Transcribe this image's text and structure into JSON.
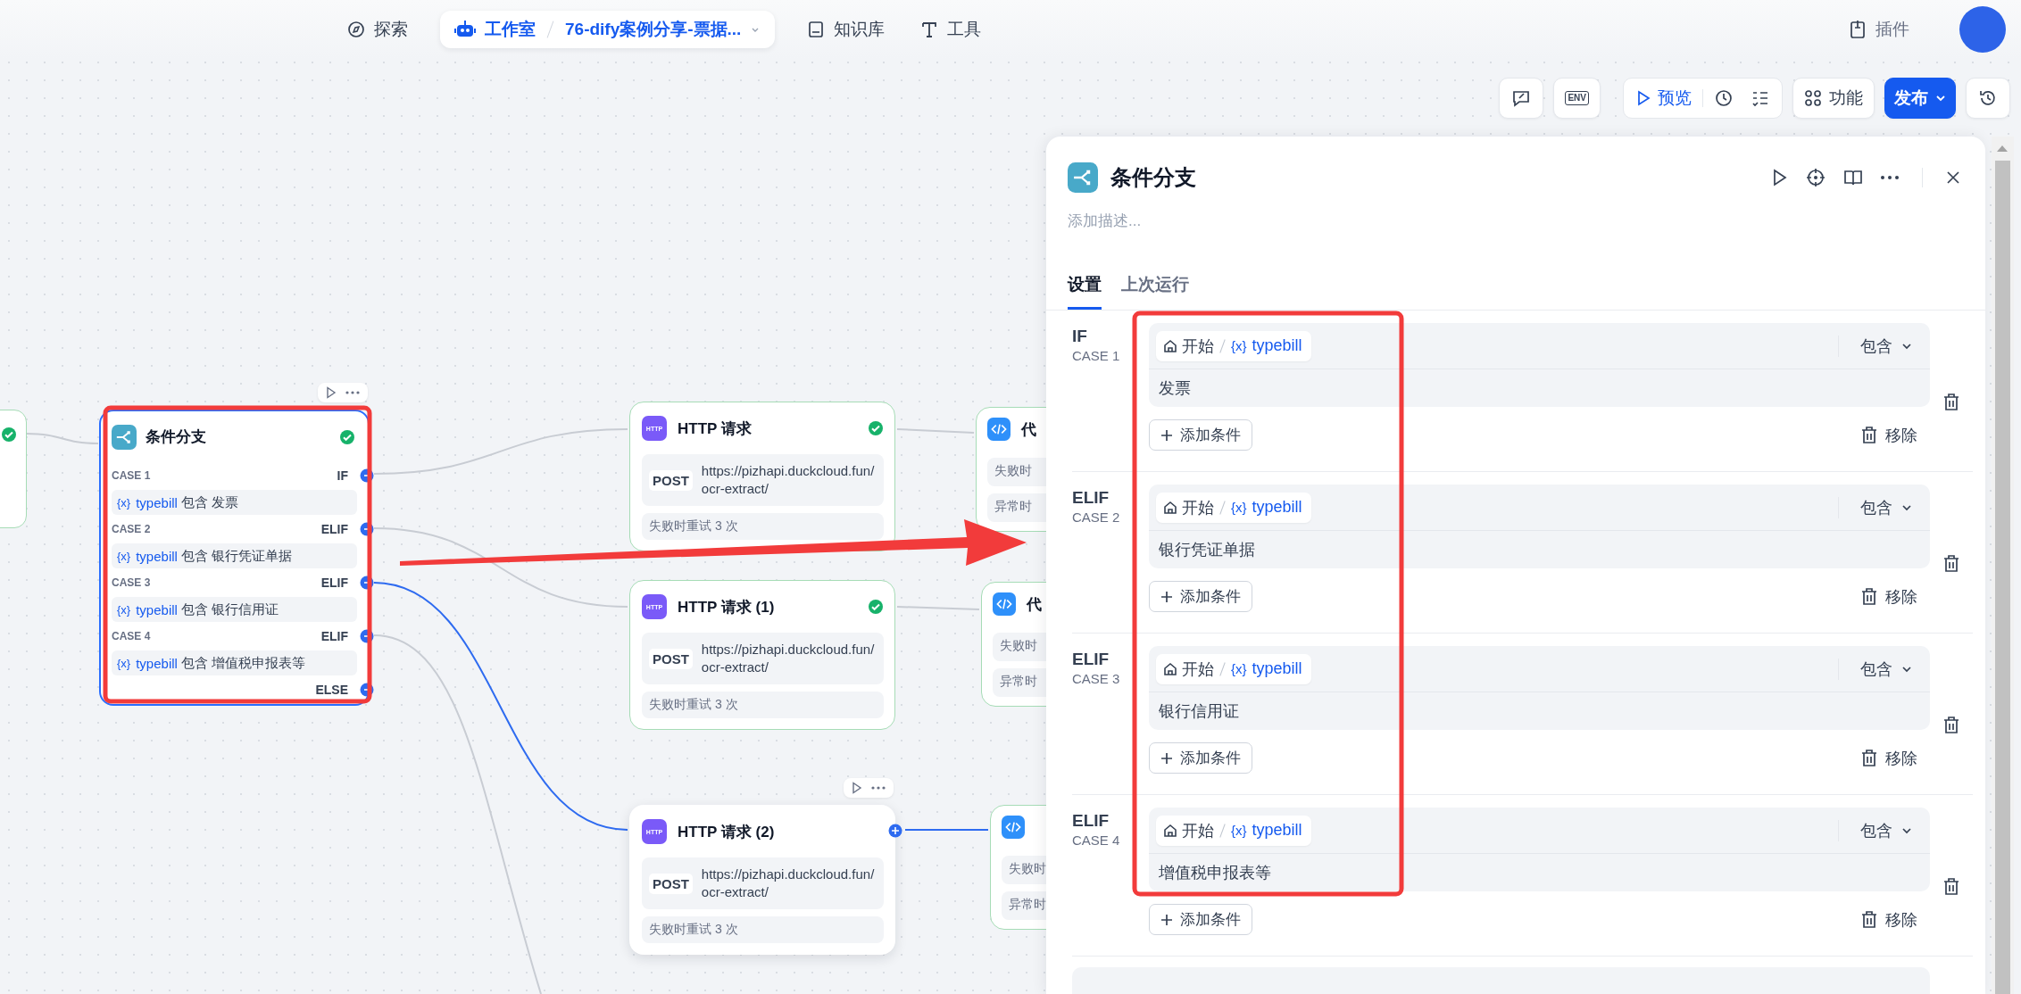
{
  "top_nav": {
    "items": [
      {
        "label": "探索",
        "selected": false
      },
      {
        "label": "工作室",
        "selected": true,
        "app_name": "76-dify案例分享-票据..."
      },
      {
        "label": "知识库",
        "selected": false
      },
      {
        "label": "工具",
        "selected": false
      }
    ],
    "plugins": "插件"
  },
  "canvas_toolbar": {
    "env": "ENV",
    "preview": "预览",
    "features": "功能",
    "publish": "发布"
  },
  "previous_node": {
    "succeeded": true
  },
  "if_else_node": {
    "title": "条件分支",
    "selected": true,
    "succeeded": true,
    "else": "ELSE",
    "cases": [
      {
        "case": "CASE 1",
        "branch": "IF",
        "var_symbol": "{x}",
        "variable": "typebill",
        "operator": "包含",
        "value": "发票"
      },
      {
        "case": "CASE 2",
        "branch": "ELIF",
        "var_symbol": "{x}",
        "variable": "typebill",
        "operator": "包含",
        "value": "银行凭证单据"
      },
      {
        "case": "CASE 3",
        "branch": "ELIF",
        "var_symbol": "{x}",
        "variable": "typebill",
        "operator": "包含",
        "value": "银行信用证"
      },
      {
        "case": "CASE 4",
        "branch": "ELIF",
        "var_symbol": "{x}",
        "variable": "typebill",
        "operator": "包含",
        "value": "增值税申报表等"
      }
    ]
  },
  "http_nodes": [
    {
      "title": "HTTP 请求",
      "icon_label": "HTTP",
      "method": "POST",
      "url": "https://pizhapi.duckcloud.fun/ocr-extract/",
      "retry": "失败时重试 3 次",
      "succeeded": true,
      "hovered": false
    },
    {
      "title": "HTTP 请求 (1)",
      "icon_label": "HTTP",
      "method": "POST",
      "url": "https://pizhapi.duckcloud.fun/ocr-extract/",
      "retry": "失败时重试 3 次",
      "succeeded": true,
      "hovered": false
    },
    {
      "title": "HTTP 请求 (2)",
      "icon_label": "HTTP",
      "method": "POST",
      "url": "https://pizhapi.duckcloud.fun/ocr-extract/",
      "retry": "失败时重试 3 次",
      "succeeded": false,
      "hovered": true
    }
  ],
  "code_nodes": [
    {
      "title": "代",
      "rows": [
        "失败时",
        "异常时"
      ]
    },
    {
      "title": "代",
      "rows": [
        "失败时",
        "异常时"
      ]
    },
    {
      "rows": [
        "失败时",
        "异常时"
      ]
    }
  ],
  "panel": {
    "title": "条件分支",
    "description": {
      "placeholder": "添加描述..."
    },
    "tabs": [
      {
        "label": "设置",
        "selected": true
      },
      {
        "label": "上次运行",
        "selected": false
      }
    ],
    "cases": [
      {
        "branch": "IF",
        "case": "CASE 1",
        "source": "开始",
        "var_symbol": "{x}",
        "variable": "typebill",
        "operator": "包含",
        "value": "发票",
        "add_condition": "添加条件",
        "remove": "移除"
      },
      {
        "branch": "ELIF",
        "case": "CASE 2",
        "source": "开始",
        "var_symbol": "{x}",
        "variable": "typebill",
        "operator": "包含",
        "value": "银行凭证单据",
        "add_condition": "添加条件",
        "remove": "移除"
      },
      {
        "branch": "ELIF",
        "case": "CASE 3",
        "source": "开始",
        "var_symbol": "{x}",
        "variable": "typebill",
        "operator": "包含",
        "value": "银行信用证",
        "add_condition": "添加条件",
        "remove": "移除"
      },
      {
        "branch": "ELIF",
        "case": "CASE 4",
        "source": "开始",
        "var_symbol": "{x}",
        "variable": "typebill",
        "operator": "包含",
        "value": "增值税申报表等",
        "add_condition": "添加条件",
        "remove": "移除"
      }
    ]
  }
}
